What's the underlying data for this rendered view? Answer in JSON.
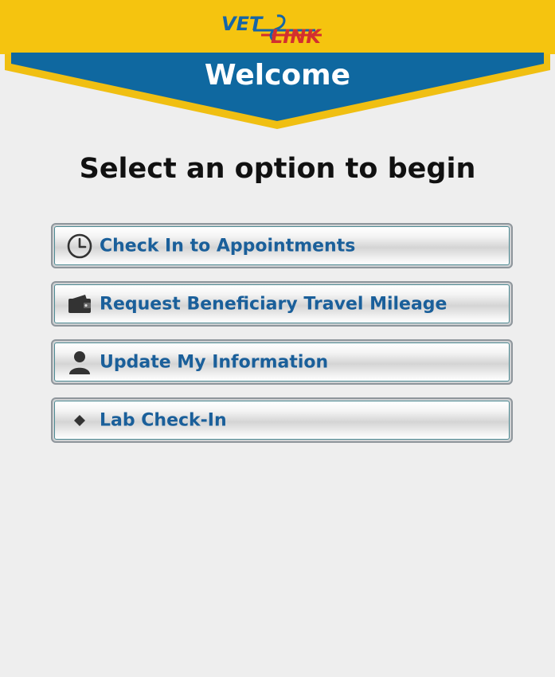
{
  "header": {
    "logo_vet": "VET",
    "logo_link": "LINK",
    "welcome": "Welcome"
  },
  "main": {
    "heading": "Select an option to begin",
    "options": [
      {
        "label": "Check In to Appointments",
        "icon": "clock-icon"
      },
      {
        "label": "Request Beneficiary Travel Mileage",
        "icon": "wallet-icon"
      },
      {
        "label": "Update My Information",
        "icon": "user-icon"
      },
      {
        "label": "Lab Check-In",
        "icon": "diamond-icon"
      }
    ]
  },
  "colors": {
    "header_yellow": "#f5c40f",
    "banner_blue": "#0f68a0",
    "option_text": "#1a5f9a",
    "background": "#eeeeee"
  }
}
